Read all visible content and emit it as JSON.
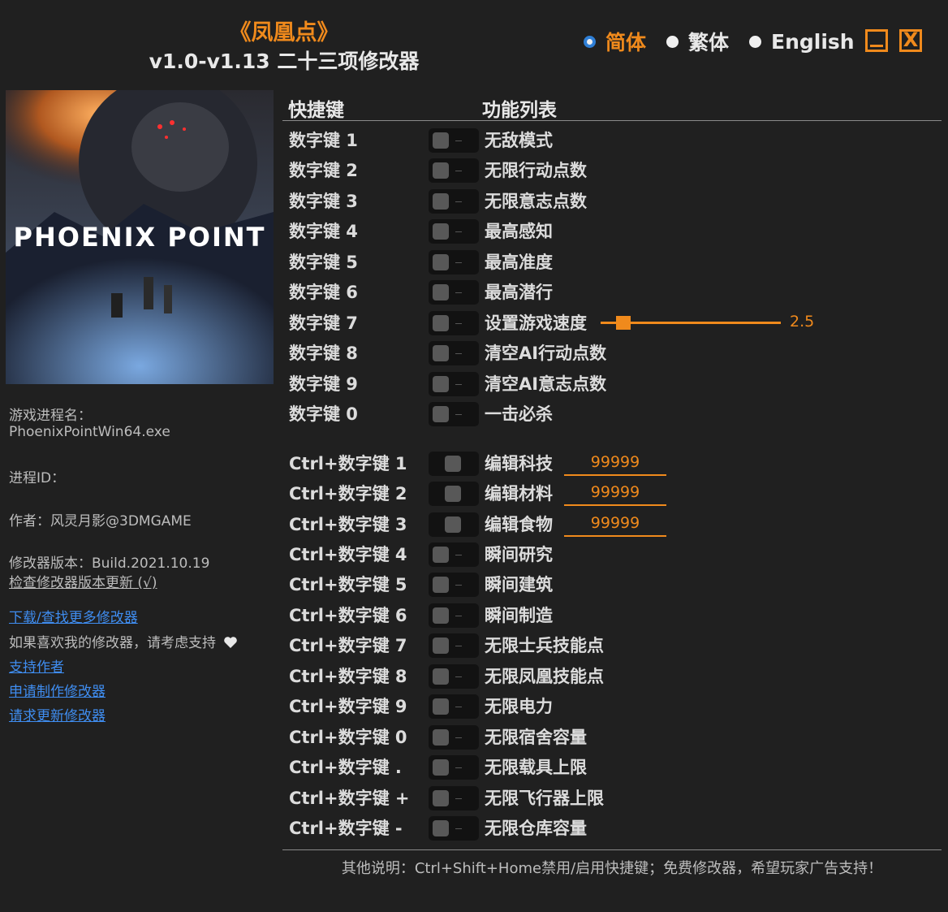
{
  "header": {
    "title": "《凤凰点》",
    "subtitle": "v1.0-v1.13 二十三项修改器"
  },
  "languages": [
    {
      "label": "简体",
      "selected": true
    },
    {
      "label": "繁体",
      "selected": false
    },
    {
      "label": "English",
      "selected": false
    }
  ],
  "window_controls": {
    "minimize_icon": "minimize-icon",
    "close_label": "X"
  },
  "cover": {
    "logo_text": "PHOENIX POINT"
  },
  "sidebar": {
    "process_label": "游戏进程名：",
    "process_name": "PhoenixPointWin64.exe",
    "pid_label": "进程ID：",
    "author": "作者：风灵月影@3DMGAME",
    "version": "修改器版本：Build.2021.10.19",
    "check_update": "检查修改器版本更新 (√)",
    "download_link": "下载/查找更多修改器",
    "support_text": "如果喜欢我的修改器，请考虑支持",
    "support_author": "支持作者",
    "request_make": "申请制作修改器",
    "request_update": "请求更新修改器"
  },
  "columns": {
    "hotkey": "快捷键",
    "features": "功能列表"
  },
  "group1": [
    {
      "key": "数字键 1",
      "name": "无敌模式"
    },
    {
      "key": "数字键 2",
      "name": "无限行动点数"
    },
    {
      "key": "数字键 3",
      "name": "无限意志点数"
    },
    {
      "key": "数字键 4",
      "name": "最高感知"
    },
    {
      "key": "数字键 5",
      "name": "最高准度"
    },
    {
      "key": "数字键 6",
      "name": "最高潜行"
    },
    {
      "key": "数字键 7",
      "name": "设置游戏速度"
    },
    {
      "key": "数字键 8",
      "name": "清空AI行动点数"
    },
    {
      "key": "数字键 9",
      "name": "清空AI意志点数"
    },
    {
      "key": "数字键 0",
      "name": "一击必杀"
    }
  ],
  "speed_slider": {
    "value": 2.5,
    "display": "2.5",
    "min": 0,
    "max": 20
  },
  "group2": [
    {
      "key": "Ctrl+数字键 1",
      "name": "编辑科技",
      "value": "99999"
    },
    {
      "key": "Ctrl+数字键 2",
      "name": "编辑材料",
      "value": "99999"
    },
    {
      "key": "Ctrl+数字键 3",
      "name": "编辑食物",
      "value": "99999"
    },
    {
      "key": "Ctrl+数字键 4",
      "name": "瞬间研究"
    },
    {
      "key": "Ctrl+数字键 5",
      "name": "瞬间建筑"
    },
    {
      "key": "Ctrl+数字键 6",
      "name": "瞬间制造"
    },
    {
      "key": "Ctrl+数字键 7",
      "name": "无限士兵技能点"
    },
    {
      "key": "Ctrl+数字键 8",
      "name": "无限凤凰技能点"
    },
    {
      "key": "Ctrl+数字键 9",
      "name": "无限电力"
    },
    {
      "key": "Ctrl+数字键 0",
      "name": "无限宿舍容量"
    },
    {
      "key": "Ctrl+数字键 .",
      "name": "无限载具上限"
    },
    {
      "key": "Ctrl+数字键 +",
      "name": "无限飞行器上限"
    },
    {
      "key": "Ctrl+数字键 -",
      "name": "无限仓库容量"
    }
  ],
  "footer": "其他说明：Ctrl+Shift+Home禁用/启用快捷键；免费修改器，希望玩家广告支持！",
  "colors": {
    "accent": "#f08a1c",
    "background": "#202020",
    "link": "#3f8df0",
    "radio_selected": "#2f7fd6"
  }
}
